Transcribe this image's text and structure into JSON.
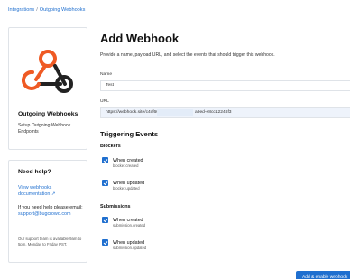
{
  "breadcrumb": {
    "parent": "Integrations",
    "separator": "/",
    "current": "Outgoing Webhooks"
  },
  "integration_card": {
    "title": "Outgoing Webhooks",
    "description": "Setup Outgoing Webhook Endpoints",
    "logo_icon": "webhook-logo-icon",
    "logo_color": "#ef5a24"
  },
  "help": {
    "title": "Need help?",
    "link_text": "View webhooks documentation ↗",
    "prompt": "If you need help please email:",
    "email": "support@bugcrowd.com",
    "availability": "Our support team is available 9am to 5pm, Monday to Friday PST."
  },
  "form": {
    "title": "Add Webhook",
    "subtitle": "Provide a name, payload URL, and select the events that should trigger this webhook.",
    "name_label": "Name",
    "name_value": "Test",
    "url_label": "URL",
    "url_value_start": "https://webhook.site/c4cf60d5-",
    "url_value_end": "a9ed-e8cc12246f3"
  },
  "events": {
    "title": "Triggering Events",
    "groups": [
      {
        "title": "Blockers",
        "items": [
          {
            "label": "When created",
            "sub": "blocker.created",
            "checked": true
          },
          {
            "label": "When updated",
            "sub": "blocker.updated",
            "checked": true
          }
        ]
      },
      {
        "title": "Submissions",
        "items": [
          {
            "label": "When created",
            "sub": "submission.created",
            "checked": true
          },
          {
            "label": "When updated",
            "sub": "submission.updated",
            "checked": true
          }
        ]
      }
    ]
  },
  "submit_label": "Add & enable webhook",
  "accent_color": "#1f6fcf"
}
